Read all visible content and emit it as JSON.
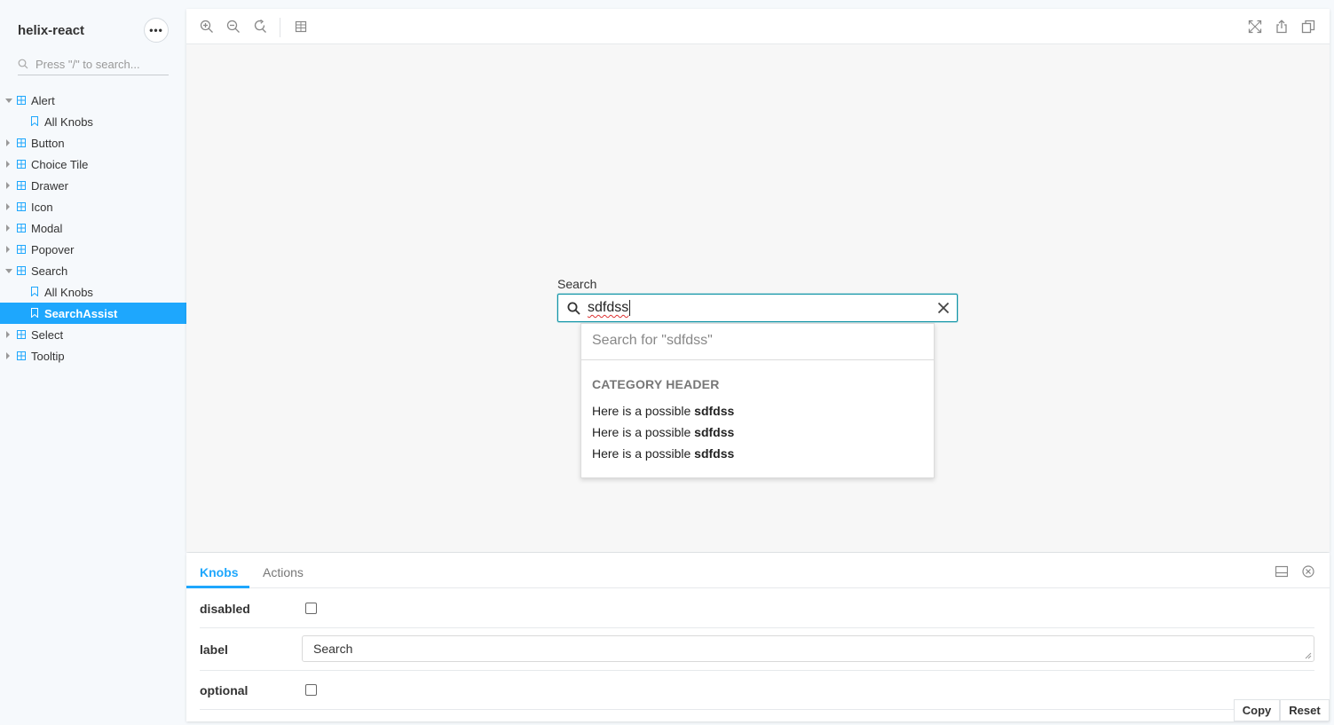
{
  "sidebar": {
    "brand": "helix-react",
    "menu_glyph": "•••",
    "search_placeholder": "Press \"/\" to search...",
    "tree": [
      {
        "label": "Alert",
        "type": "component",
        "expanded": true
      },
      {
        "label": "All Knobs",
        "type": "story"
      },
      {
        "label": "Button",
        "type": "component",
        "expanded": false
      },
      {
        "label": "Choice Tile",
        "type": "component",
        "expanded": false
      },
      {
        "label": "Drawer",
        "type": "component",
        "expanded": false
      },
      {
        "label": "Icon",
        "type": "component",
        "expanded": false
      },
      {
        "label": "Modal",
        "type": "component",
        "expanded": false
      },
      {
        "label": "Popover",
        "type": "component",
        "expanded": false
      },
      {
        "label": "Search",
        "type": "component",
        "expanded": true
      },
      {
        "label": "All Knobs",
        "type": "story"
      },
      {
        "label": "SearchAssist",
        "type": "story",
        "selected": true
      },
      {
        "label": "Select",
        "type": "component",
        "expanded": false
      },
      {
        "label": "Tooltip",
        "type": "component",
        "expanded": false
      }
    ]
  },
  "toolbar": {
    "left_icons": [
      "zoom-in-icon",
      "zoom-out-icon",
      "zoom-reset-icon",
      "background-grid-icon"
    ],
    "right_icons": [
      "fullscreen-icon",
      "share-icon",
      "copy-link-icon"
    ]
  },
  "preview": {
    "field_label": "Search",
    "field_value": "sdfdss",
    "dropdown": {
      "search_for": "Search for \"sdfdss\"",
      "category_header": "CATEGORY HEADER",
      "items": [
        {
          "prefix": "Here is a possible ",
          "match": "sdfdss"
        },
        {
          "prefix": "Here is a possible ",
          "match": "sdfdss"
        },
        {
          "prefix": "Here is a possible ",
          "match": "sdfdss"
        }
      ]
    }
  },
  "addons": {
    "tabs": [
      {
        "label": "Knobs",
        "active": true
      },
      {
        "label": "Actions",
        "active": false
      }
    ],
    "knobs": {
      "disabled": {
        "name": "disabled",
        "checked": false
      },
      "label": {
        "name": "label",
        "value": "Search"
      },
      "optional": {
        "name": "optional",
        "checked": false
      }
    },
    "buttons": {
      "copy": "Copy",
      "reset": "Reset"
    }
  },
  "colors": {
    "accent": "#1ea7fd",
    "focus_border": "#0e94a6",
    "sidebar_bg": "#f6f9fc"
  }
}
